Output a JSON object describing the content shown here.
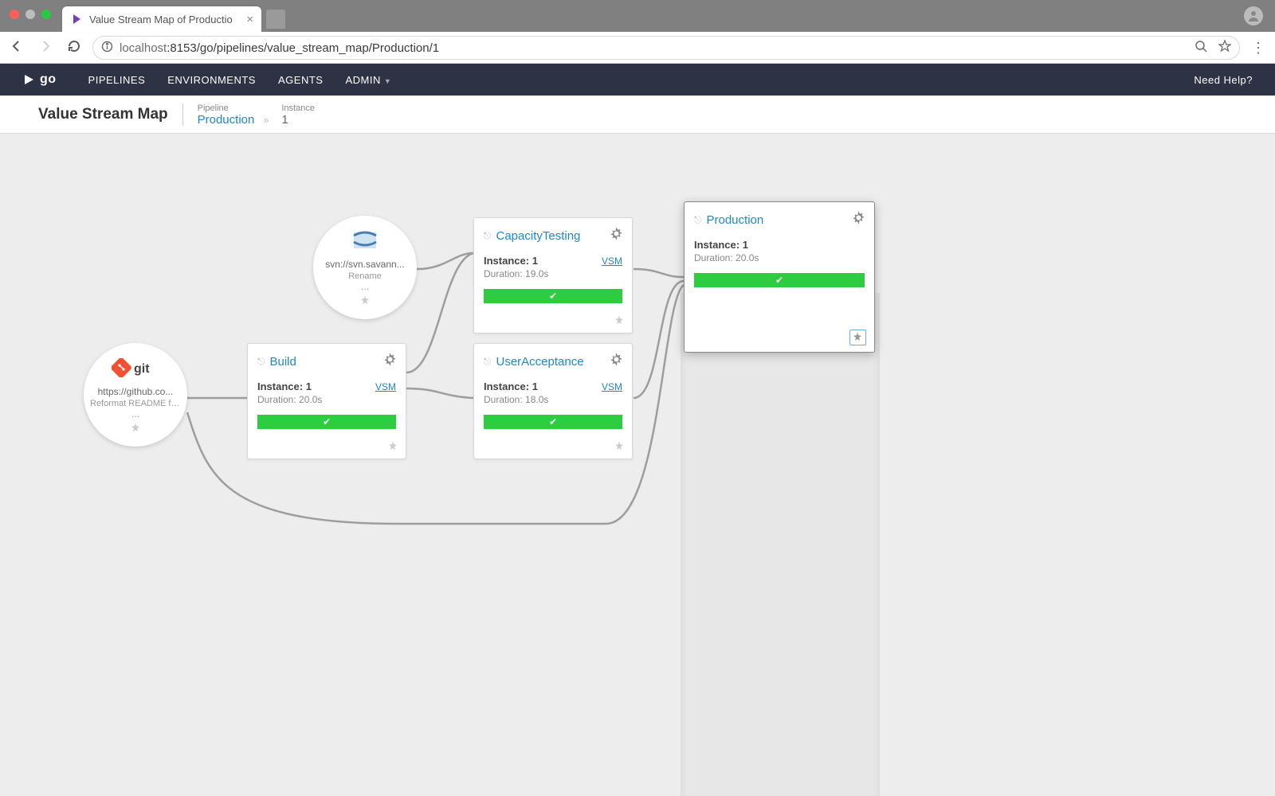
{
  "browser": {
    "tab_title": "Value Stream Map of Productio",
    "url_host": "localhost",
    "url_port": ":8153",
    "url_path": "/go/pipelines/value_stream_map/Production/1"
  },
  "header": {
    "brand": "go",
    "nav": [
      "PIPELINES",
      "ENVIRONMENTS",
      "AGENTS",
      "ADMIN"
    ],
    "help": "Need Help?"
  },
  "subheader": {
    "title": "Value Stream Map",
    "pipeline_label": "Pipeline",
    "pipeline_value": "Production",
    "instance_label": "Instance",
    "instance_value": "1"
  },
  "materials": {
    "svn": {
      "url": "svn://svn.savann...",
      "msg": "Rename",
      "dots": "..."
    },
    "git": {
      "url": "https://github.co...",
      "msg": "Reformat README for...",
      "dots": "..."
    }
  },
  "cards": {
    "build": {
      "name": "Build",
      "instance_label": "Instance:",
      "instance": "1",
      "duration": "Duration: 20.0s",
      "vsm": "VSM"
    },
    "capacity": {
      "name": "CapacityTesting",
      "instance_label": "Instance:",
      "instance": "1",
      "duration": "Duration: 19.0s",
      "vsm": "VSM"
    },
    "useracc": {
      "name": "UserAcceptance",
      "instance_label": "Instance:",
      "instance": "1",
      "duration": "Duration: 18.0s",
      "vsm": "VSM"
    },
    "production": {
      "name": "Production",
      "instance_label": "Instance:",
      "instance": "1",
      "duration": "Duration: 20.0s"
    }
  }
}
